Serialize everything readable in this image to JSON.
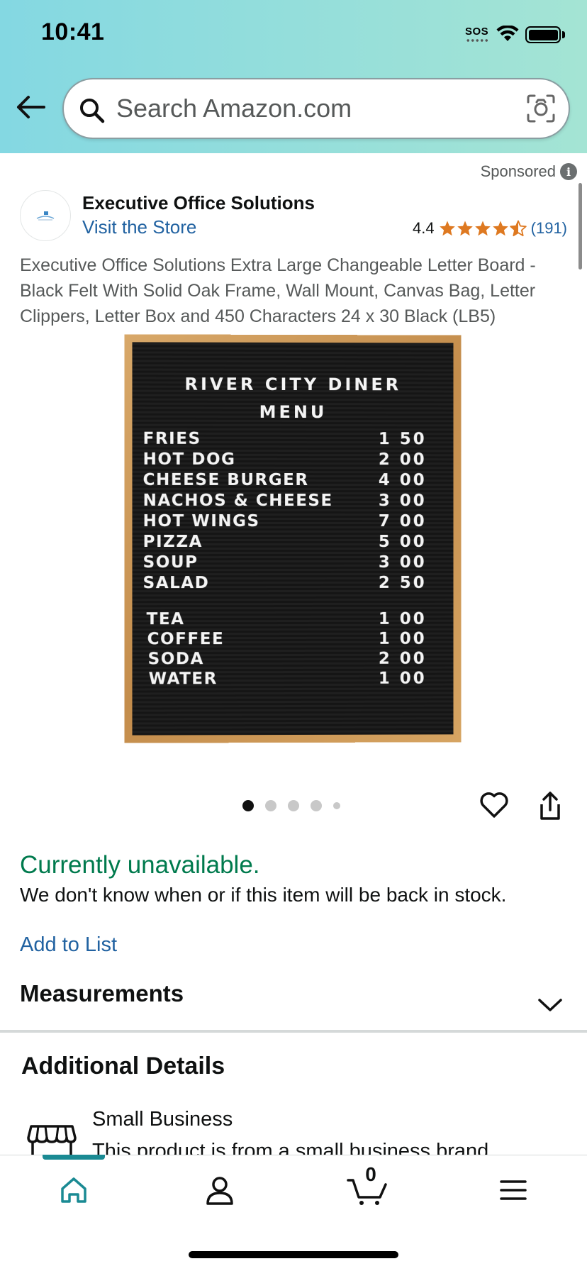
{
  "status_bar": {
    "time": "10:41",
    "sos": "SOS"
  },
  "search": {
    "placeholder": "Search Amazon.com"
  },
  "sponsored": {
    "label": "Sponsored",
    "info": "i"
  },
  "brand": {
    "name": "Executive Office Solutions",
    "store_link": "Visit the Store",
    "rating": "4.4",
    "rating_stars": 4.4,
    "review_count": "(191)"
  },
  "product": {
    "title": "Executive Office Solutions Extra Large Changeable Letter Board - Black Felt With Solid Oak Frame, Wall Mount, Canvas Bag, Letter Clippers, Letter Box and 450 Characters 24 x 30 Black (LB5)"
  },
  "board": {
    "title": "RIVER CITY DINER",
    "subtitle": "MENU",
    "items": [
      {
        "name": "FRIES",
        "price": "1 50"
      },
      {
        "name": "HOT DOG",
        "price": "2 00"
      },
      {
        "name": "CHEESE BURGER",
        "price": "4 00"
      },
      {
        "name": "NACHOS & CHEESE",
        "price": "3 00"
      },
      {
        "name": "HOT WINGS",
        "price": "7 00"
      },
      {
        "name": "PIZZA",
        "price": "5 00"
      },
      {
        "name": "SOUP",
        "price": "3 00"
      },
      {
        "name": "SALAD",
        "price": "2 50"
      },
      {
        "name": "TEA",
        "price": "1 00"
      },
      {
        "name": "COFFEE",
        "price": "1 00"
      },
      {
        "name": "SODA",
        "price": "2 00"
      },
      {
        "name": "WATER",
        "price": "1 00"
      }
    ]
  },
  "carousel": {
    "active_index": 0,
    "count": 5
  },
  "availability": {
    "status": "Currently unavailable.",
    "note": "We don't know when or if this item will be back in stock.",
    "add_to_list": "Add to List"
  },
  "measurements": {
    "title": "Measurements"
  },
  "additional": {
    "title": "Additional Details",
    "badge_title": "Small Business",
    "badge_desc": "This product is from a small business brand."
  },
  "bottom_nav": {
    "cart_count": "0"
  },
  "colors": {
    "accent_link": "#2162a1",
    "available_green": "#007a4d",
    "star_orange": "#de7921",
    "nav_teal": "#1a8a93"
  }
}
